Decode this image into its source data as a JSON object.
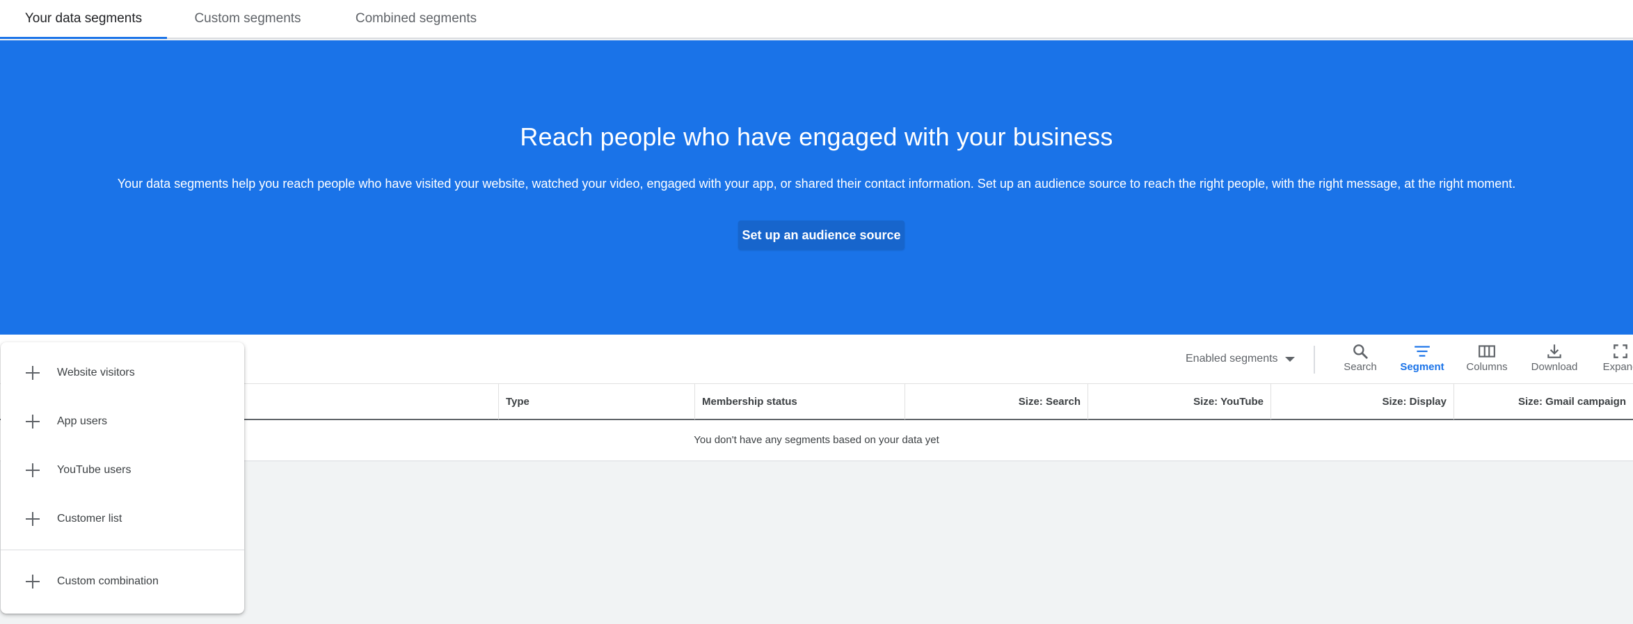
{
  "tabs": [
    {
      "label": "Your data segments",
      "active": true
    },
    {
      "label": "Custom segments",
      "active": false
    },
    {
      "label": "Combined segments",
      "active": false
    }
  ],
  "hero": {
    "title": "Reach people who have engaged with your business",
    "description": "Your data segments help you reach people who have visited your website, watched your video, engaged with your app, or shared their contact information. Set up an audience source to reach the right people, with the right message, at the right moment.",
    "button_label": "Set up an audience source"
  },
  "toolbar": {
    "filter_label": "Enabled segments",
    "buttons": [
      {
        "label": "Search",
        "icon": "search-icon"
      },
      {
        "label": "Segment",
        "icon": "segment-icon",
        "active": true
      },
      {
        "label": "Columns",
        "icon": "columns-icon"
      },
      {
        "label": "Download",
        "icon": "download-icon"
      },
      {
        "label": "Expand",
        "icon": "expand-icon"
      }
    ]
  },
  "table": {
    "headers": [
      "Type",
      "Membership status",
      "Size: Search",
      "Size: YouTube",
      "Size: Display",
      "Size: Gmail campaign"
    ],
    "empty_message": "You don't have any segments based on your data yet"
  },
  "menu": {
    "items": [
      {
        "label": "Website visitors"
      },
      {
        "label": "App users"
      },
      {
        "label": "YouTube users"
      },
      {
        "label": "Customer list"
      },
      {
        "label": "Custom combination"
      }
    ]
  },
  "colors": {
    "accent": "#1a73e8",
    "button": "#1765cc",
    "background": "#f1f3f4"
  }
}
